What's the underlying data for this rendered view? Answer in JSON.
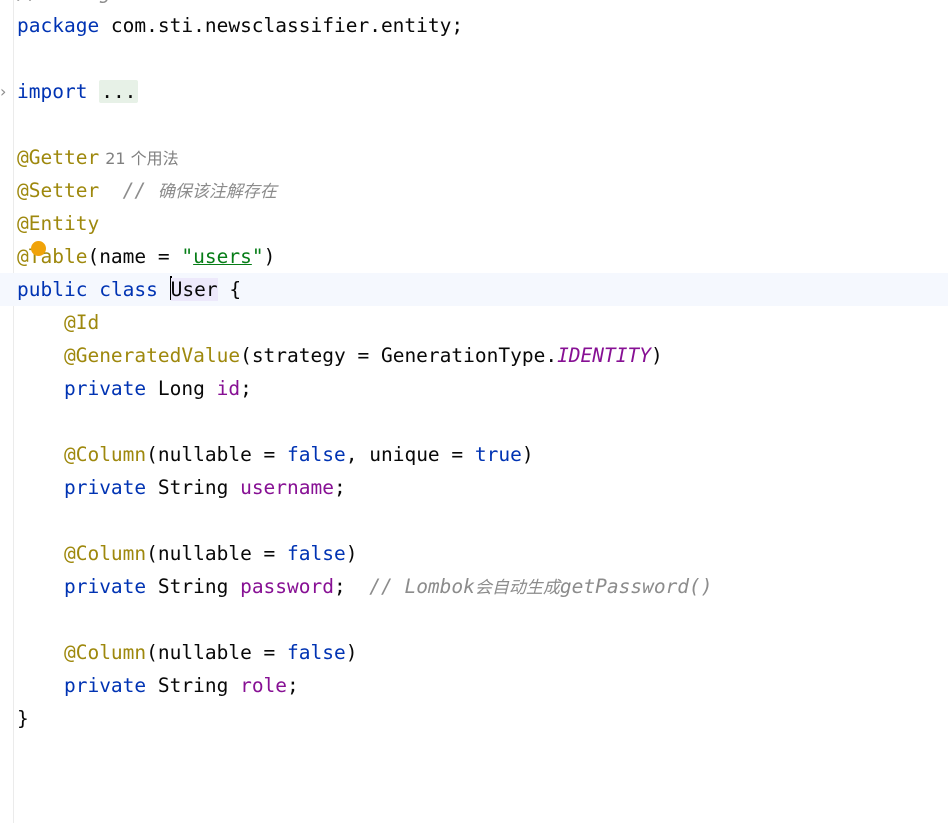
{
  "editor": {
    "top_fragment": "// Using",
    "lines": {
      "l1": {
        "kw": "package",
        "rest": " com.sti.newsclassifier.entity;"
      },
      "l2": {
        "kw": "import",
        "ellipsis": "..."
      },
      "l3": {
        "ann": "@Getter",
        "hint": "21 个用法"
      },
      "l4": {
        "ann": "@Setter",
        "comment_prefix": "// ",
        "comment": "确保该注解存在"
      },
      "l5": {
        "ann": "@Entity"
      },
      "l6": {
        "ann": "@Table",
        "open": "(name = ",
        "q1": "\"",
        "str": "users",
        "q2": "\"",
        "close": ")"
      },
      "l7": {
        "kw1": "public",
        "kw2": "class",
        "cls": "User",
        "brace": " {"
      },
      "l8": {
        "ann": "@Id"
      },
      "l9": {
        "ann": "@GeneratedValue",
        "open": "(strategy = GenerationType.",
        "const": "IDENTITY",
        "close": ")"
      },
      "l10": {
        "kw": "private",
        "type": " Long ",
        "fld": "id",
        "semi": ";"
      },
      "l11": {
        "ann": "@Column",
        "p1": "(nullable = ",
        "v1": "false",
        "p2": ", unique = ",
        "v2": "true",
        "close": ")"
      },
      "l12": {
        "kw": "private",
        "type": " String ",
        "fld": "username",
        "semi": ";"
      },
      "l13": {
        "ann": "@Column",
        "p1": "(nullable = ",
        "v1": "false",
        "close": ")"
      },
      "l14": {
        "kw": "private",
        "type": " String ",
        "fld": "password",
        "semi": ";  ",
        "comment_prefix": "// Lombok",
        "comment_cn1": "会自动生成",
        "comment_tail": "getPassword()"
      },
      "l15": {
        "ann": "@Column",
        "p1": "(nullable = ",
        "v1": "false",
        "close": ")"
      },
      "l16": {
        "kw": "private",
        "type": " String ",
        "fld": "role",
        "semi": ";"
      },
      "l17": {
        "brace": "}"
      }
    }
  },
  "colors": {
    "keyword": "#0033b3",
    "annotation": "#9e880d",
    "field": "#871094",
    "string": "#067d17",
    "comment": "#8c8c8c",
    "caret_line": "#f5f8fe",
    "bulb": "#f0a30a"
  },
  "icons": {
    "fold": "chevron-right-icon",
    "intention": "lightbulb-icon"
  }
}
